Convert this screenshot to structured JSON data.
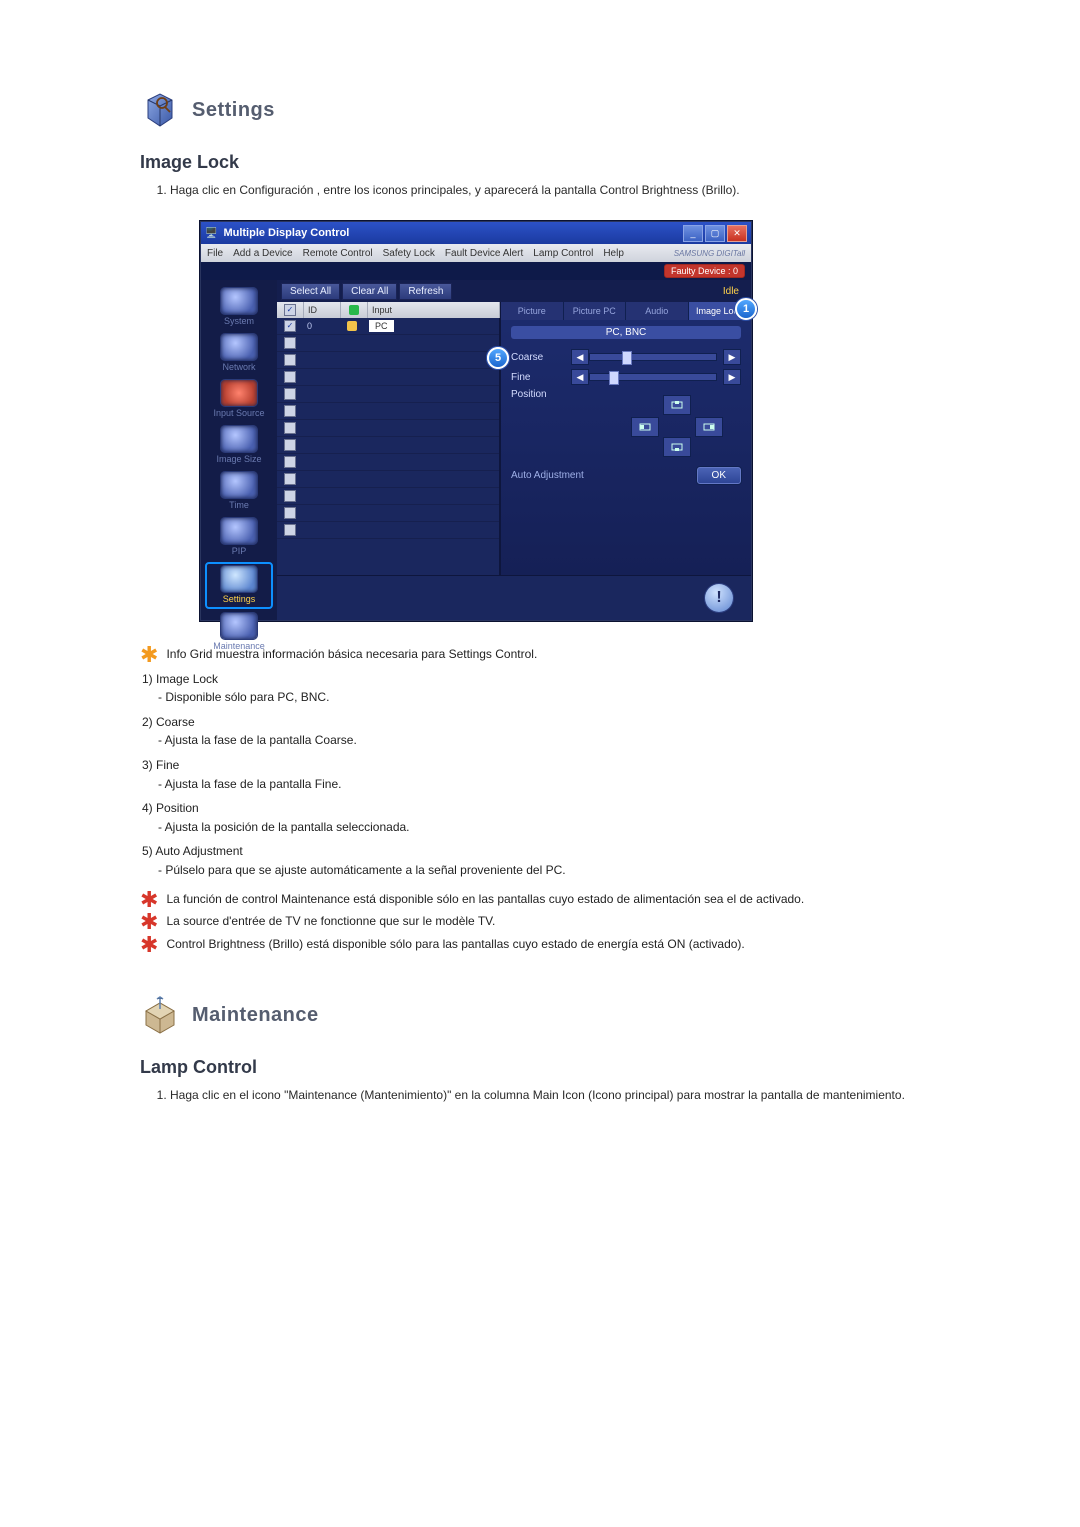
{
  "settings_section": {
    "title": "Settings",
    "subtitle": "Image Lock",
    "instruction": "Haga clic en Configuración , entre los iconos principales, y aparecerá la pantalla Control Brightness (Brillo)."
  },
  "window": {
    "title": "Multiple Display Control",
    "menus": [
      "File",
      "Add a Device",
      "Remote Control",
      "Safety Lock",
      "Fault Device Alert",
      "Lamp Control",
      "Help"
    ],
    "brand": "SAMSUNG DIGITall",
    "status_pill": "Faulty Device : 0",
    "toolbar": {
      "select_all": "Select All",
      "clear_all": "Clear All",
      "refresh": "Refresh",
      "idle": "Idle"
    },
    "grid_headers": {
      "id": "ID",
      "input": "Input"
    },
    "grid_first_row": {
      "id": "0",
      "input": "PC"
    },
    "leftnav": {
      "items": [
        {
          "label": "System"
        },
        {
          "label": "Network"
        },
        {
          "label": "Input Source"
        },
        {
          "label": "Image Size"
        },
        {
          "label": "Time"
        },
        {
          "label": "PIP"
        },
        {
          "label": "Settings"
        },
        {
          "label": "Maintenance"
        }
      ]
    },
    "right": {
      "tabs": [
        "Picture",
        "Picture PC",
        "Audio",
        "Image Lock"
      ],
      "source": "PC, BNC",
      "coarse": "Coarse",
      "fine": "Fine",
      "position": "Position",
      "auto_adjustment": "Auto Adjustment",
      "ok": "OK"
    }
  },
  "explain": {
    "star_intro": "Info Grid muestra información básica necesaria para Settings Control.",
    "items": [
      {
        "n": "1)",
        "title": "Image Lock",
        "desc": "- Disponible sólo para PC, BNC."
      },
      {
        "n": "2)",
        "title": "Coarse",
        "desc": "- Ajusta la fase de la pantalla Coarse."
      },
      {
        "n": "3)",
        "title": "Fine",
        "desc": "- Ajusta la fase de la pantalla Fine."
      },
      {
        "n": "4)",
        "title": "Position",
        "desc": "- Ajusta la posición de la pantalla seleccionada."
      },
      {
        "n": "5)",
        "title": "Auto Adjustment",
        "desc": "- Púlselo para que se ajuste automáticamente a la señal proveniente del PC."
      }
    ],
    "warns": [
      "La función de control Maintenance está disponible sólo en las pantallas cuyo estado de alimentación sea el de activado.",
      "La source d'entrée de TV ne fonctionne que sur le modèle TV.",
      "Control Brightness (Brillo) está disponible sólo para las pantallas cuyo estado de energía está ON (activado)."
    ]
  },
  "maintenance_section": {
    "title": "Maintenance",
    "subtitle": "Lamp Control",
    "instruction": "Haga clic en el icono \"Maintenance (Mantenimiento)\" en la columna Main Icon (Icono principal) para mostrar la pantalla de mantenimiento."
  }
}
